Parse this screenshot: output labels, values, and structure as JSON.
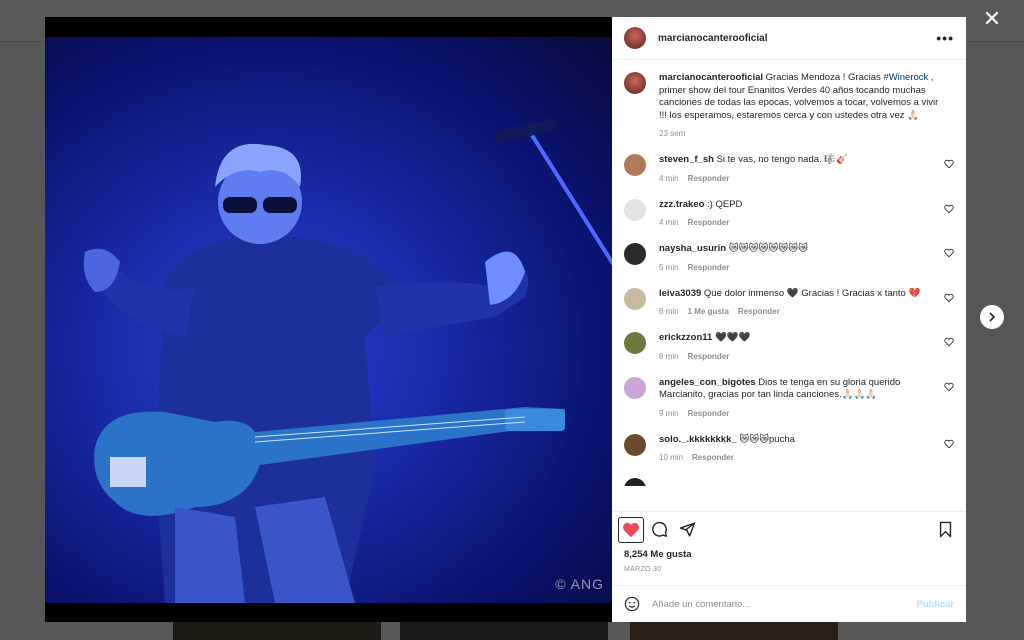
{
  "post": {
    "username": "marcianocanterooficial",
    "caption_user": "marcianocanterooficial",
    "caption_text_1": " Gracias Mendoza ! Gracias ",
    "caption_tag": "#Winerock",
    "caption_text_2": " , primer show del tour Enanitos Verdes 40 años tocando muchas canciones de todas las epocas, volvemos a tocar, volvemos a vivir !!! los esperamos, estaremos cerca y con ustedes otra vez 🙏🏻",
    "caption_time": "23 sem",
    "likes": "8,254 Me gusta",
    "date": "MARZO 30",
    "watermark": "© ANG"
  },
  "comments": [
    {
      "user": "steven_f_sh",
      "text": " Si te vas, no tengo nada. 🎼🎸",
      "time": "4 min",
      "likes": "",
      "reply": "Responder",
      "avatar_color": "#b07a5a"
    },
    {
      "user": "zzz.trakeo",
      "text": " :) QEPD",
      "time": "4 min",
      "likes": "",
      "reply": "Responder",
      "avatar_color": "#e3e3e3"
    },
    {
      "user": "naysha_usurin",
      "text": " 😿😿😿😿😿😿😿😿",
      "time": "5 min",
      "likes": "",
      "reply": "Responder",
      "avatar_color": "#2a2a2a"
    },
    {
      "user": "leiva3039",
      "text": " Que dolor inmenso 🖤 Gracias ! Gracias x tanto 💔",
      "time": "6 min",
      "likes": "1 Me gusta",
      "reply": "Responder",
      "avatar_color": "#c9b9a2"
    },
    {
      "user": "erickzzon11",
      "text": " 🖤🖤🖤",
      "time": "8 min",
      "likes": "",
      "reply": "Responder",
      "avatar_color": "#6a7a3a"
    },
    {
      "user": "angeles_con_bigotes",
      "text": " Dios te tenga en su gloria querido Marcianito, gracias por tan linda canciones.🙏🏻🙏🏻🙏🏻",
      "time": "9 min",
      "likes": "",
      "reply": "Responder",
      "avatar_color": "#c8a6d8"
    },
    {
      "user": "solo._.kkkkkkkk_",
      "text": " 😿😿😿pucha",
      "time": "10 min",
      "likes": "",
      "reply": "Responder",
      "avatar_color": "#6a4a2a"
    }
  ],
  "comment_box": {
    "placeholder": "Añade un comentario...",
    "post_label": "Publicar"
  },
  "colors": {
    "like_red": "#ed4956",
    "link_blue": "#00376b",
    "post_disabled": "#b2dffc"
  },
  "icons": {
    "close": "close-icon",
    "next": "chevron-right-icon",
    "more": "more-horizontal-icon",
    "like": "heart-filled-icon",
    "comment": "comment-icon",
    "share": "send-icon",
    "save": "bookmark-icon",
    "emoji": "emoji-icon"
  }
}
